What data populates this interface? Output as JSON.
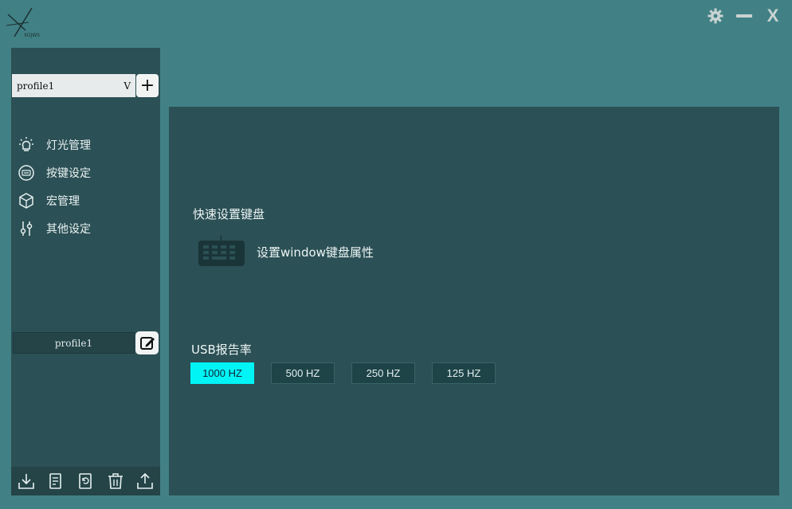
{
  "logo": {
    "text": "XOJWS"
  },
  "window": {
    "settings_icon": "gear-icon",
    "minimize_icon": "minimize-icon",
    "close_glyph": "X"
  },
  "sidebar": {
    "profile_select": {
      "value": "profile1",
      "caret": "V"
    },
    "add_label": "+",
    "nav_items": [
      {
        "label": "灯光管理",
        "icon": "light-bulb-icon"
      },
      {
        "label": "按键设定",
        "icon": "key-icon"
      },
      {
        "label": "宏管理",
        "icon": "macro-cube-icon"
      },
      {
        "label": "其他设定",
        "icon": "sliders-icon"
      }
    ],
    "profile_name": "profile1",
    "bottom_icons": [
      "import-icon",
      "notes-icon",
      "reset-icon",
      "delete-icon",
      "export-icon"
    ]
  },
  "main": {
    "quick_title": "快速设置键盘",
    "keyboard_label": "设置window键盘属性",
    "usb_title": "USB报告率",
    "rates": [
      "1000 HZ",
      "500 HZ",
      "250 HZ",
      "125 HZ"
    ],
    "active_rate": "1000 HZ"
  },
  "colors": {
    "background": "#418185",
    "panel": "#2b5055",
    "accent": "#00f4f6"
  }
}
